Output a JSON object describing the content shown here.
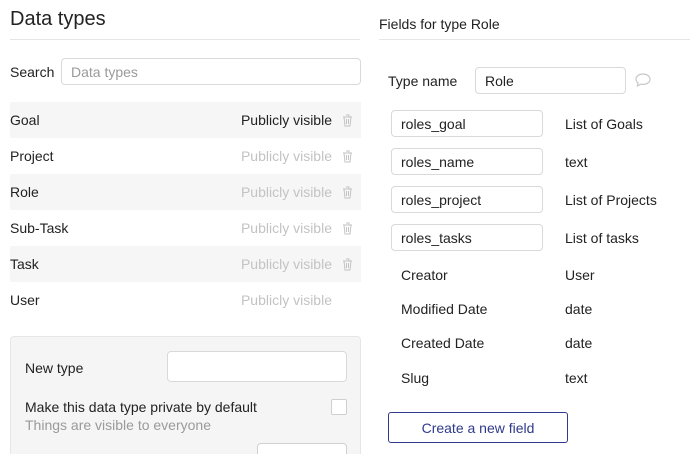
{
  "data_types": {
    "title": "Data types",
    "search": {
      "label": "Search",
      "placeholder": "Data types",
      "value": ""
    },
    "types": [
      {
        "name": "Goal",
        "visibility": "Publicly visible",
        "active": true,
        "deletable": true
      },
      {
        "name": "Project",
        "visibility": "Publicly visible",
        "active": false,
        "deletable": true
      },
      {
        "name": "Role",
        "visibility": "Publicly visible",
        "active": false,
        "deletable": true
      },
      {
        "name": "Sub-Task",
        "visibility": "Publicly visible",
        "active": false,
        "deletable": true
      },
      {
        "name": "Task",
        "visibility": "Publicly visible",
        "active": false,
        "deletable": true
      },
      {
        "name": "User",
        "visibility": "Publicly visible",
        "active": false,
        "deletable": false
      }
    ],
    "new_type": {
      "label": "New type",
      "value": "",
      "private_label": "Make this data type private by default",
      "private_sublabel": "Things are visible to everyone",
      "private_checked": false
    }
  },
  "fields_panel": {
    "title": "Fields for type Role",
    "type_name_label": "Type name",
    "type_name_value": "Role",
    "editable_fields": [
      {
        "name": "roles_goal",
        "type": "List of Goals"
      },
      {
        "name": "roles_name",
        "type": "text"
      },
      {
        "name": "roles_project",
        "type": "List of Projects"
      },
      {
        "name": "roles_tasks",
        "type": "List of tasks"
      }
    ],
    "builtin_fields": [
      {
        "name": "Creator",
        "type": "User"
      },
      {
        "name": "Modified Date",
        "type": "date"
      },
      {
        "name": "Created Date",
        "type": "date"
      },
      {
        "name": "Slug",
        "type": "text"
      }
    ],
    "create_field_label": "Create a new field"
  },
  "colors": {
    "accent": "#2f3a8c",
    "muted_text": "#c3c3c3",
    "alt_row": "#f6f6f6"
  }
}
